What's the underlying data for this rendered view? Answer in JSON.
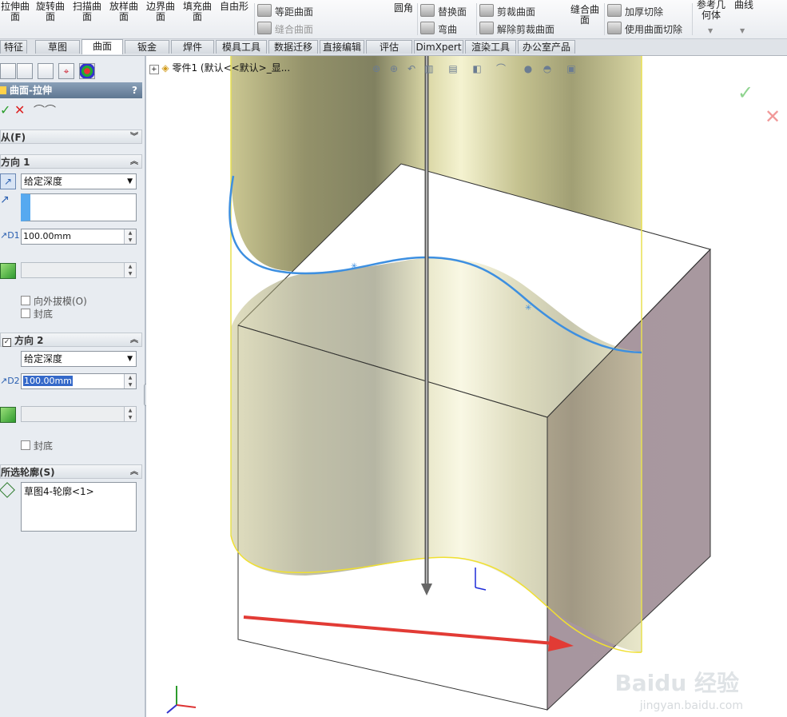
{
  "ribbon": {
    "big_buttons": [
      {
        "label": "拉伸曲\n面"
      },
      {
        "label": "旋转曲\n面"
      },
      {
        "label": "扫描曲\n面"
      },
      {
        "label": "放样曲\n面"
      },
      {
        "label": "边界曲\n面"
      },
      {
        "label": "填充曲\n面"
      },
      {
        "label": "自由形"
      }
    ],
    "small_group_1": [
      "等距曲面",
      "缝合曲面"
    ],
    "fillet": "圆角",
    "small_group_2": [
      "替换面",
      "弯曲"
    ],
    "small_group_3": [
      "剪裁曲面",
      "解除剪裁曲面"
    ],
    "knit": "缝合曲\n面",
    "small_group_4": [
      "加厚切除",
      "使用曲面切除"
    ],
    "ref_geom": "参考几\n何体",
    "curves": "曲线"
  },
  "tabs": [
    "特征",
    "草图",
    "曲面",
    "钣金",
    "焊件",
    "模具工具",
    "数据迁移",
    "直接编辑",
    "评估",
    "DimXpert",
    "渲染工具",
    "办公室产品"
  ],
  "active_tab": "曲面",
  "panel": {
    "title": "曲面-拉伸",
    "help": "?",
    "from_section": "从(F)",
    "dir1": {
      "title": "方向 1",
      "end_condition": "给定深度",
      "depth": "100.00mm",
      "draft_outward": "向外拔模(O)",
      "cap": "封底"
    },
    "dir2": {
      "title": "方向 2",
      "end_condition": "给定深度",
      "depth": "100.00mm",
      "cap": "封底"
    },
    "contours": {
      "title": "所选轮廓(S)",
      "item": "草图4-轮廓<1>"
    }
  },
  "graphics": {
    "tree_label": "零件1  (默认<<默认>_显...",
    "watermark": "Baidu 经验",
    "watermark_url": "jingyan.baidu.com"
  },
  "colors": {
    "accent_blue": "#3d8fe0",
    "surface": "#c9c693",
    "side_face": "#a6959f",
    "arrow_red": "#e23b35",
    "ok_green": "#5cb85c",
    "cancel_red": "#e55"
  }
}
